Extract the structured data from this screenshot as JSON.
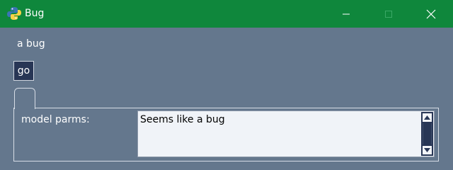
{
  "window": {
    "title": "Bug",
    "icon": "python-icon",
    "controls": [
      "minimize-icon",
      "maximize-icon",
      "close-icon"
    ],
    "titlebar_color": "#0f873c"
  },
  "main": {
    "label_text": "a bug",
    "go_button_label": "go",
    "param_label": "model parms:",
    "textbox_value": "Seems like a bug"
  },
  "colors": {
    "background": "#64778d",
    "button_bg": "#283655",
    "textbox_bg": "#f0f3f8"
  }
}
